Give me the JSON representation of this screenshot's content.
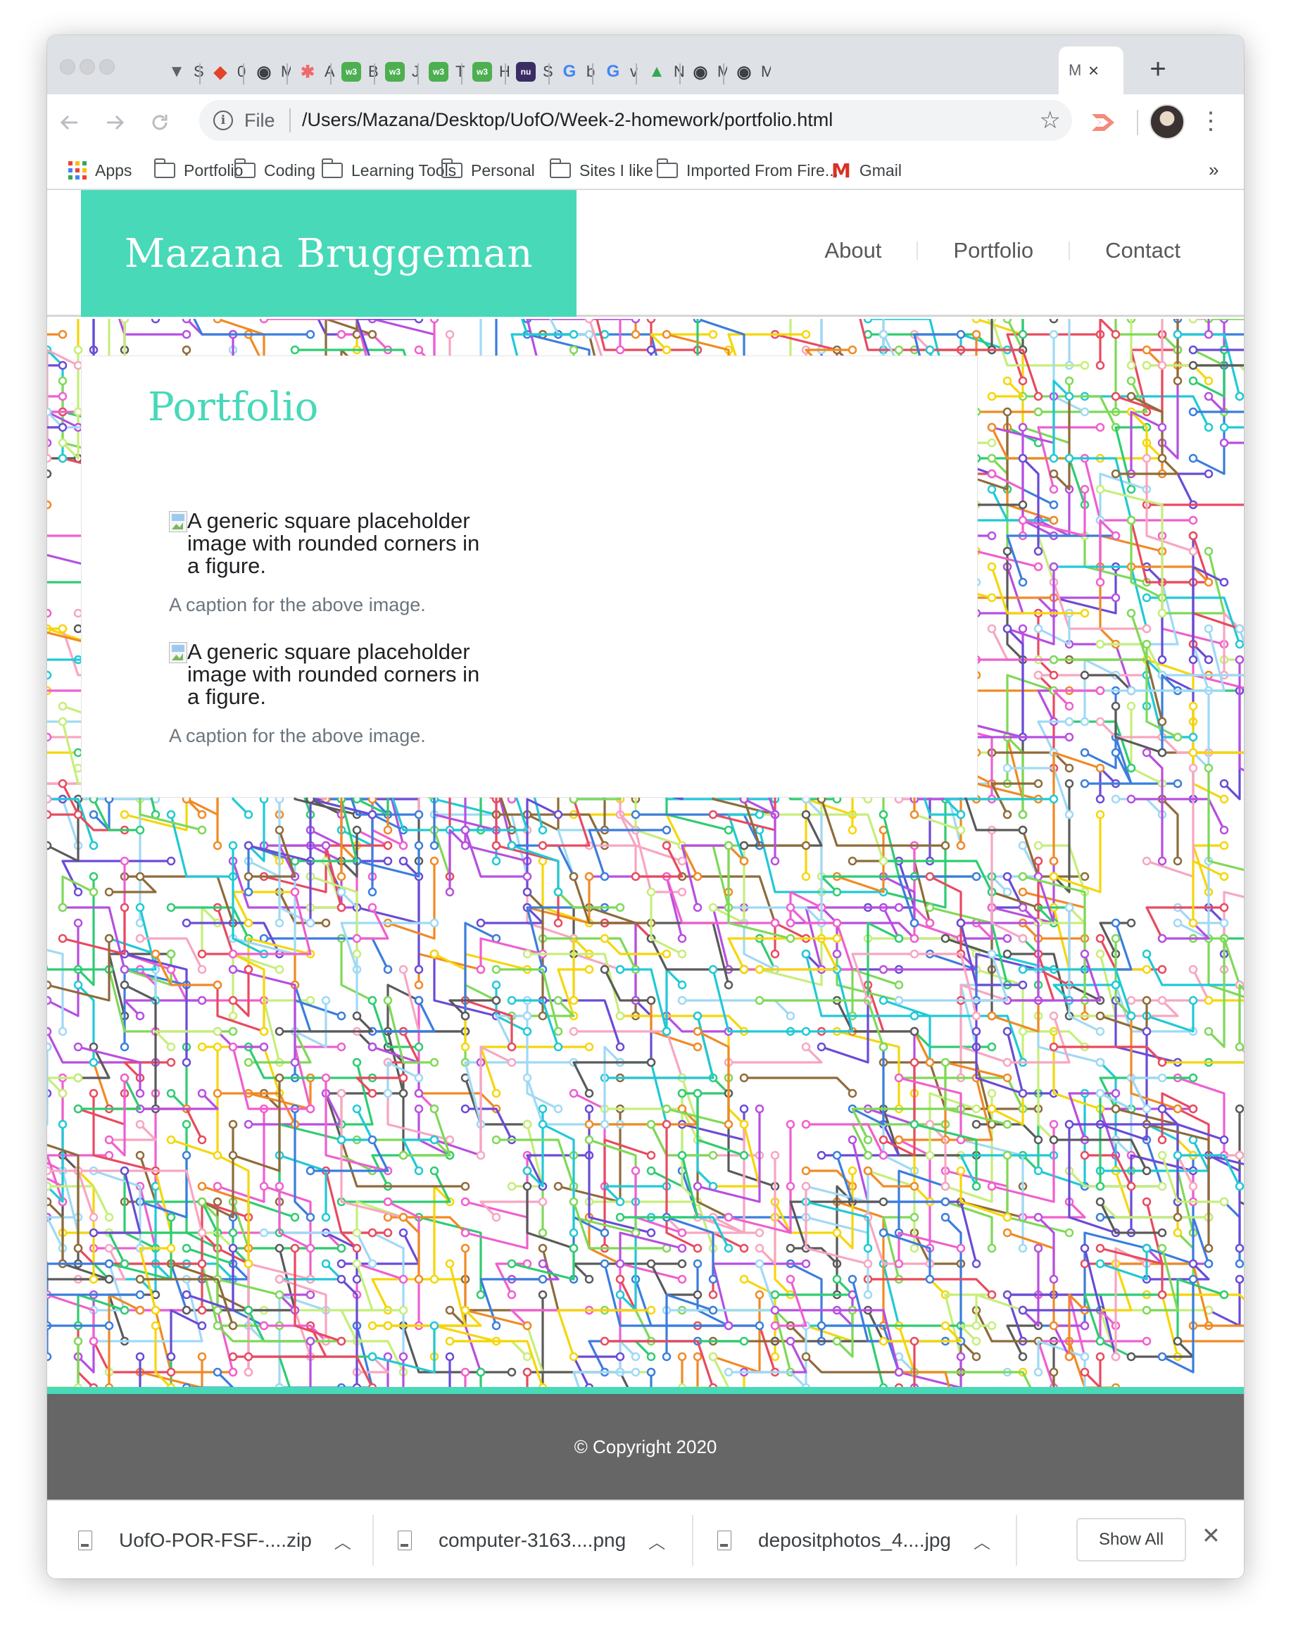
{
  "browser": {
    "tabs": [
      {
        "title": "S",
        "icon": "shield-icon",
        "color": "#5f6368"
      },
      {
        "title": "0",
        "icon": "gitlab-icon",
        "color": "#e2432a"
      },
      {
        "title": "M",
        "icon": "globe-icon",
        "color": "#3c4043"
      },
      {
        "title": "A",
        "icon": "asterisk-icon",
        "color": "#f06a6a"
      },
      {
        "title": "B",
        "icon": "w3-icon",
        "color": "#4caf50"
      },
      {
        "title": "J",
        "icon": "w3-icon",
        "color": "#4caf50"
      },
      {
        "title": "T",
        "icon": "w3-icon",
        "color": "#4caf50"
      },
      {
        "title": "H",
        "icon": "w3-icon",
        "color": "#4caf50"
      },
      {
        "title": "S",
        "icon": "nu-icon",
        "color": "#3a2d64"
      },
      {
        "title": "b",
        "icon": "google-icon",
        "color": "#4285f4"
      },
      {
        "title": "v",
        "icon": "google-icon",
        "color": "#4285f4"
      },
      {
        "title": "N",
        "icon": "drive-icon",
        "color": "#34a853"
      },
      {
        "title": "M",
        "icon": "globe-icon",
        "color": "#3c4043"
      },
      {
        "title": "M",
        "icon": "globe-icon",
        "color": "#3c4043"
      }
    ],
    "active_tab_title": "M",
    "new_tab_label": "+",
    "address": {
      "scheme_label": "File",
      "url": "/Users/Mazana/Desktop/UofO/Week-2-homework/portfolio.html"
    },
    "bookmarks": [
      {
        "label": "Apps",
        "icon": "apps-grid-icon"
      },
      {
        "label": "Portfolio",
        "icon": "folder-icon"
      },
      {
        "label": "Coding",
        "icon": "folder-icon"
      },
      {
        "label": "Learning Tools",
        "icon": "folder-icon"
      },
      {
        "label": "Personal",
        "icon": "folder-icon"
      },
      {
        "label": "Sites I like",
        "icon": "folder-icon"
      },
      {
        "label": "Imported From Fire...",
        "icon": "folder-icon"
      },
      {
        "label": "Gmail",
        "icon": "gmail-icon"
      }
    ],
    "bookmarks_overflow": "»"
  },
  "site": {
    "brand": "Mazana Bruggeman",
    "nav": [
      "About",
      "Portfolio",
      "Contact"
    ],
    "heading": "Portfolio",
    "figures": [
      {
        "alt": "A generic square placeholder image with rounded corners in a figure.",
        "caption": "A caption for the above image."
      },
      {
        "alt": "A generic square placeholder image with rounded corners in a figure.",
        "caption": "A caption for the above image."
      }
    ],
    "footer": "© Copyright 2020",
    "accent_color": "#47d9b8",
    "footer_color": "#666666"
  },
  "downloads": {
    "items": [
      {
        "name": "UofO-POR-FSF-....zip",
        "type": "zip"
      },
      {
        "name": "computer-3163....png",
        "type": "png"
      },
      {
        "name": "depositphotos_4....jpg",
        "type": "jpg"
      }
    ],
    "show_all": "Show All"
  }
}
